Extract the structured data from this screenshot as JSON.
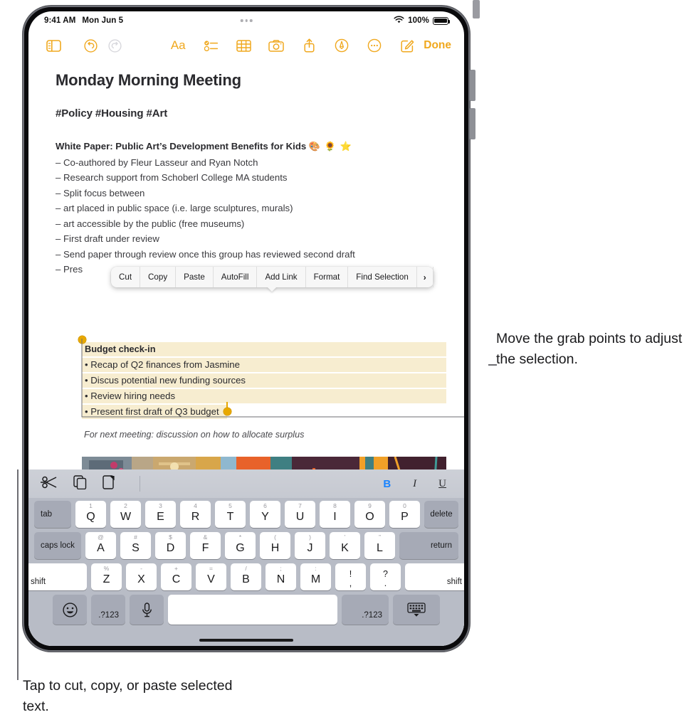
{
  "device": {
    "status_bar": {
      "time": "9:41 AM",
      "date": "Mon Jun 5",
      "battery_percent": "100%",
      "wifi_icon": "wifi-icon",
      "battery_icon": "battery-full-icon"
    },
    "toolbar": {
      "sidebar_icon": "sidebar-toggle-icon",
      "undo_icon": "undo-icon",
      "redo_icon": "redo-icon",
      "format_icon": "Aa",
      "checklist_icon": "checklist-icon",
      "table_icon": "table-icon",
      "camera_icon": "camera-icon",
      "share_icon": "share-icon",
      "markup_icon": "markup-pen-icon",
      "more_icon": "more-options-icon",
      "compose_icon": "compose-note-icon",
      "done_label": "Done"
    }
  },
  "note": {
    "title": "Monday Morning Meeting",
    "tags": "#Policy #Housing #Art",
    "heading": "White Paper: Public Art’s Development Benefits for Kids",
    "heading_emoji": "🎨 🌻 ⭐",
    "lines": [
      "– Co-authored by Fleur Lasseur and Ryan Notch",
      "– Research support from Schoberl College MA students",
      "– Split focus between",
      "– art placed in public space (i.e. large sculptures, murals)",
      "– art accessible by the public (free museums)",
      "– First draft under review",
      "– Send paper through review once this group has reviewed second draft",
      "– Pres"
    ],
    "selection": {
      "rows": [
        "Budget check-in",
        "• Recap of Q2 finances from Jasmine",
        "• Discus potential new funding sources",
        "• Review hiring needs",
        "• Present first draft of Q3 budget"
      ],
      "highlight_color": "#f7edd0",
      "grab_point_color": "#e8a800"
    },
    "footer_italic": "For next meeting: discussion on how to allocate surplus",
    "photo_alt": "photo-mural-street-art"
  },
  "context_menu": {
    "items": [
      "Cut",
      "Copy",
      "Paste",
      "AutoFill",
      "Add Link",
      "Format",
      "Find Selection"
    ],
    "more_chevron": "›"
  },
  "keyboard": {
    "shortcut_bar": {
      "cut_icon": "scissors-cut-icon",
      "copy_icon": "copy-icon",
      "paste_icon": "paste-icon",
      "bold_label": "B",
      "italic_label": "I",
      "underline_label": "U",
      "bold_active_color": "#1a84ff"
    },
    "row1": {
      "tab": "tab",
      "keys": [
        {
          "main": "Q",
          "alt": "1"
        },
        {
          "main": "W",
          "alt": "2"
        },
        {
          "main": "E",
          "alt": "3"
        },
        {
          "main": "R",
          "alt": "4"
        },
        {
          "main": "T",
          "alt": "5"
        },
        {
          "main": "Y",
          "alt": "6"
        },
        {
          "main": "U",
          "alt": "7"
        },
        {
          "main": "I",
          "alt": "8"
        },
        {
          "main": "O",
          "alt": "9"
        },
        {
          "main": "P",
          "alt": "0"
        }
      ],
      "delete": "delete"
    },
    "row2": {
      "caps_lock": "caps lock",
      "keys": [
        {
          "main": "A",
          "alt": "@"
        },
        {
          "main": "S",
          "alt": "#"
        },
        {
          "main": "D",
          "alt": "$"
        },
        {
          "main": "F",
          "alt": "&"
        },
        {
          "main": "G",
          "alt": "*"
        },
        {
          "main": "H",
          "alt": "("
        },
        {
          "main": "J",
          "alt": ")"
        },
        {
          "main": "K",
          "alt": "’"
        },
        {
          "main": "L",
          "alt": "”"
        }
      ],
      "return": "return"
    },
    "row3": {
      "shift_left": "shift",
      "keys": [
        {
          "main": "Z",
          "alt": "%"
        },
        {
          "main": "X",
          "alt": "-"
        },
        {
          "main": "C",
          "alt": "+"
        },
        {
          "main": "V",
          "alt": "="
        },
        {
          "main": "B",
          "alt": "/"
        },
        {
          "main": "N",
          "alt": ";"
        },
        {
          "main": "M",
          "alt": ":"
        }
      ],
      "punct": [
        {
          "top": "!",
          "bot": ","
        },
        {
          "top": "?",
          "bot": "."
        }
      ],
      "shift_right": "shift"
    },
    "row4": {
      "emoji_icon": "emoji-smiley-icon",
      "numeric_left": ".?123",
      "mic_icon": "microphone-icon",
      "space": "",
      "numeric_right": ".?123",
      "dismiss_icon": "dismiss-keyboard-icon"
    }
  },
  "callouts": {
    "right": "Move the grab points to adjust the selection.",
    "bottom": "Tap to cut, copy, or paste selected text."
  }
}
